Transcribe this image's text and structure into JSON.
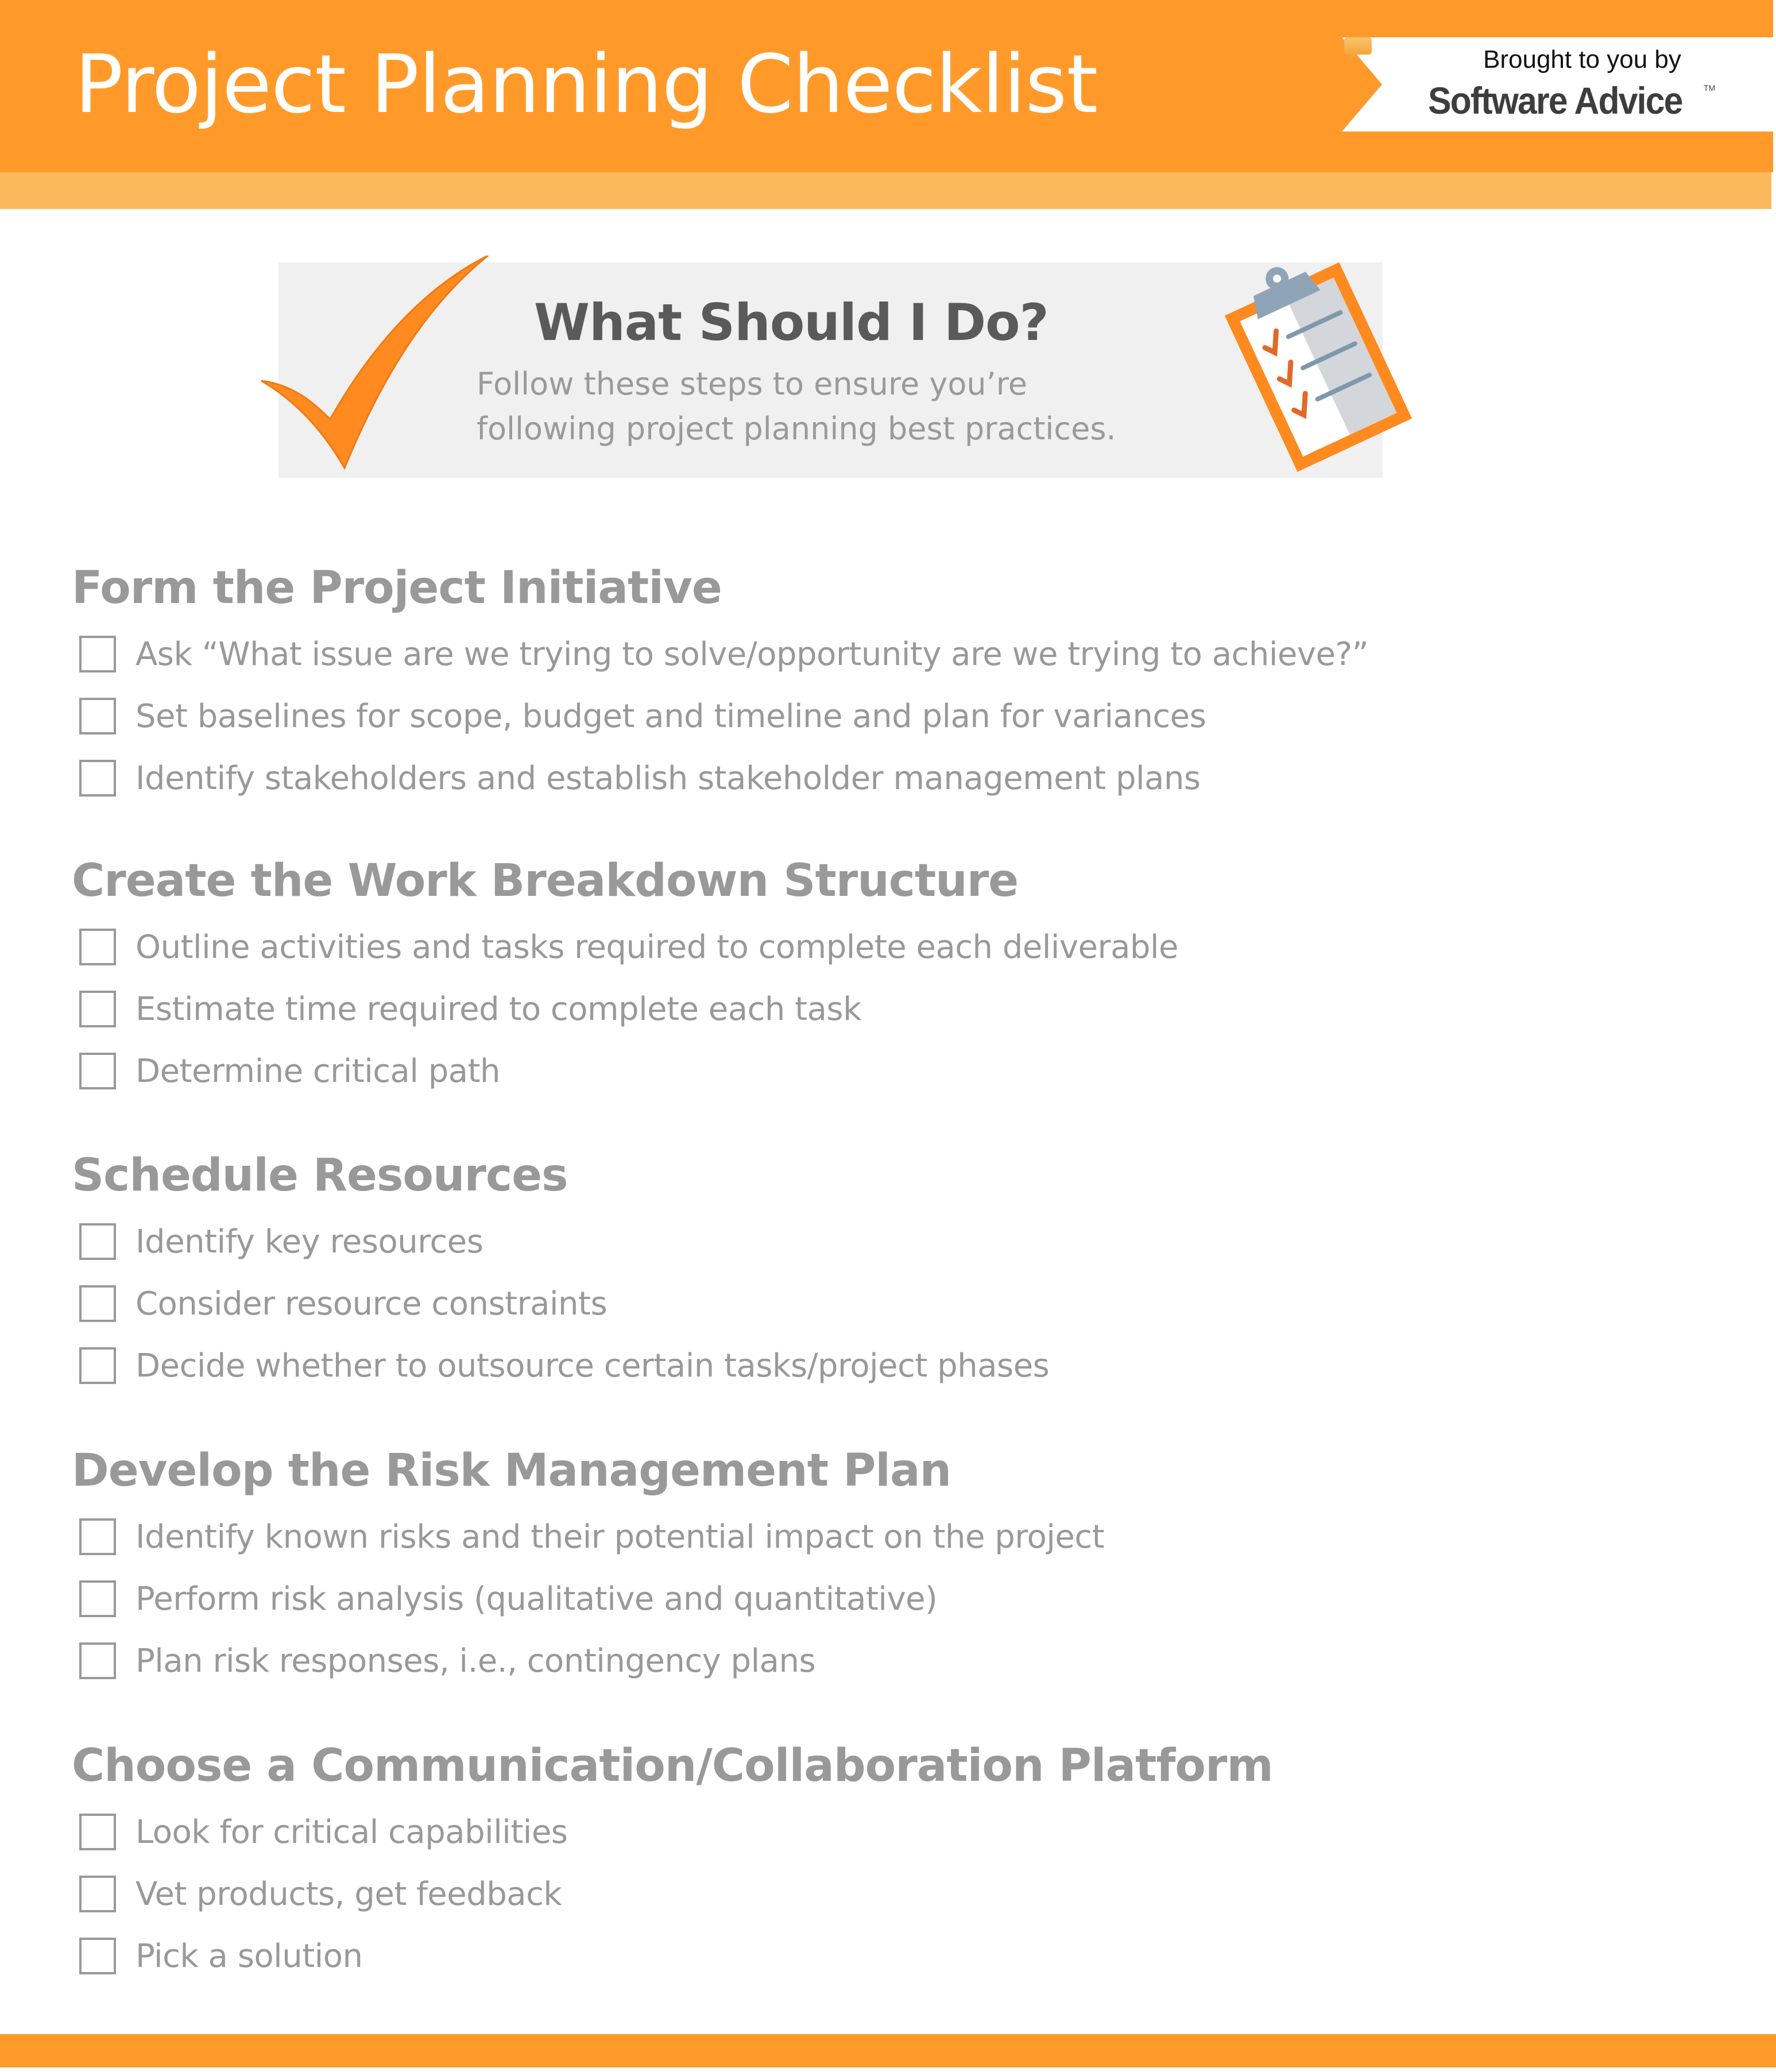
{
  "header": {
    "title": "Project Planning Checklist",
    "brand_color": "#FF9A2A",
    "band_color": "#FBB95C"
  },
  "logo": {
    "tagline": "Brought to you by",
    "name": "Software Advice",
    "trademark": "TM",
    "icon": "speech-bubble-icon"
  },
  "intro": {
    "title": "What Should I Do?",
    "lines": [
      "Follow these steps to ensure you’re",
      "following project planning best practices."
    ],
    "icons": [
      "checkmark-icon",
      "clipboard-icon"
    ]
  },
  "sections": [
    {
      "title": "Form the Project Initiative",
      "items": [
        {
          "label": "Ask “What issue are we trying to solve/opportunity are we trying to achieve?”",
          "checked": false
        },
        {
          "label": "Set baselines for scope, budget and timeline and plan for variances",
          "checked": false
        },
        {
          "label": "Identify stakeholders and establish stakeholder management plans",
          "checked": false
        }
      ]
    },
    {
      "title": "Create the Work Breakdown Structure",
      "items": [
        {
          "label": "Outline activities and tasks required to complete each deliverable",
          "checked": false
        },
        {
          "label": "Estimate time required to complete each task",
          "checked": false
        },
        {
          "label": "Determine critical path",
          "checked": false
        }
      ]
    },
    {
      "title": "Schedule Resources",
      "items": [
        {
          "label": "Identify key resources",
          "checked": false
        },
        {
          "label": "Consider resource constraints",
          "checked": false
        },
        {
          "label": "Decide whether to outsource certain tasks/project phases",
          "checked": false
        }
      ]
    },
    {
      "title": "Develop the Risk Management Plan",
      "items": [
        {
          "label": "Identify known risks and their potential impact on the project",
          "checked": false
        },
        {
          "label": "Perform risk analysis (qualitative and quantitative)",
          "checked": false
        },
        {
          "label": "Plan risk responses, i.e., contingency plans",
          "checked": false
        }
      ]
    },
    {
      "title": "Choose a Communication/Collaboration Platform",
      "items": [
        {
          "label": "Look for critical capabilities",
          "checked": false
        },
        {
          "label": "Vet products, get feedback",
          "checked": false
        },
        {
          "label": "Pick a solution",
          "checked": false
        }
      ]
    }
  ]
}
